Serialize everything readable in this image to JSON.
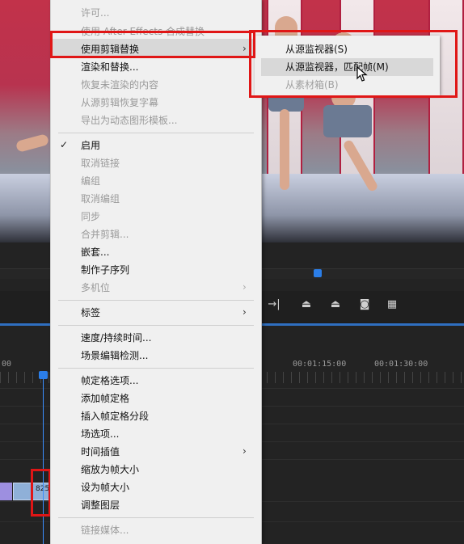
{
  "context_menu": {
    "items_top": [
      {
        "label": "许可...",
        "disabled": true
      },
      {
        "label": "使用 After Effects 合成替换",
        "disabled": true
      },
      {
        "label": "使用剪辑替换",
        "disabled": false,
        "submenu": true
      },
      {
        "label": "渲染和替换...",
        "disabled": false
      },
      {
        "label": "恢复未渲染的内容",
        "disabled": true
      },
      {
        "label": "从源剪辑恢复字幕",
        "disabled": true
      },
      {
        "label": "导出为动态图形模板...",
        "disabled": true
      }
    ],
    "items_group2": [
      {
        "label": "启用",
        "checked": true
      },
      {
        "label": "取消链接",
        "disabled": true
      },
      {
        "label": "编组",
        "disabled": true
      },
      {
        "label": "取消编组",
        "disabled": true
      },
      {
        "label": "同步",
        "disabled": true
      },
      {
        "label": "合并剪辑...",
        "disabled": true
      },
      {
        "label": "嵌套...",
        "disabled": false
      },
      {
        "label": "制作子序列",
        "disabled": false
      },
      {
        "label": "多机位",
        "disabled": true,
        "submenu": true
      }
    ],
    "items_group3": [
      {
        "label": "标签",
        "submenu": true
      }
    ],
    "items_group4": [
      {
        "label": "速度/持续时间..."
      },
      {
        "label": "场景编辑检测..."
      }
    ],
    "items_group5": [
      {
        "label": "帧定格选项..."
      },
      {
        "label": "添加帧定格"
      },
      {
        "label": "插入帧定格分段"
      },
      {
        "label": "场选项..."
      },
      {
        "label": "时间插值",
        "submenu": true
      },
      {
        "label": "缩放为帧大小"
      },
      {
        "label": "设为帧大小"
      },
      {
        "label": "调整图层"
      }
    ],
    "items_group6": [
      {
        "label": "链接媒体...",
        "disabled": true
      }
    ]
  },
  "submenu": {
    "items": [
      {
        "label": "从源监视器(S)",
        "disabled": false
      },
      {
        "label": "从源监视器，匹配帧(M)",
        "disabled": false,
        "hover": true
      },
      {
        "label": "从素材箱(B)",
        "disabled": true
      }
    ]
  },
  "timeline": {
    "timecodes": [
      "00",
      "00:01:15:00",
      "00:01:30:00"
    ],
    "clip_label": "825"
  },
  "colors": {
    "accent": "#2b7ee8",
    "highlight_box": "#e01616"
  }
}
